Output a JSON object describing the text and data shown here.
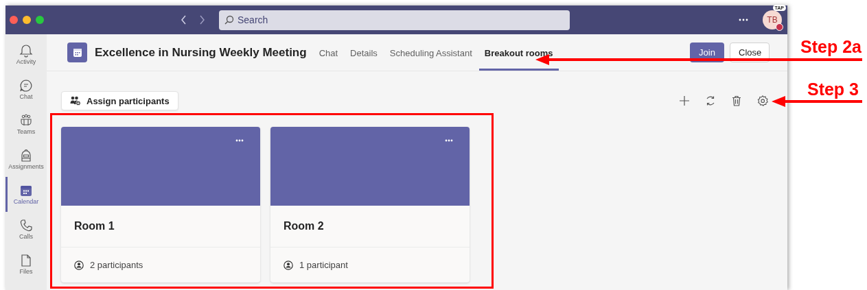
{
  "title_bar": {
    "search": {
      "placeholder": "Search"
    },
    "avatar": {
      "initials": "TB",
      "badge": "TAP"
    }
  },
  "sidebar": {
    "items": [
      {
        "label": "Activity",
        "selected": false
      },
      {
        "label": "Chat",
        "selected": false
      },
      {
        "label": "Teams",
        "selected": false
      },
      {
        "label": "Assignments",
        "selected": false
      },
      {
        "label": "Calendar",
        "selected": true
      },
      {
        "label": "Calls",
        "selected": false
      },
      {
        "label": "Files",
        "selected": false
      }
    ]
  },
  "meeting": {
    "title": "Excellence in Nursing Weekly Meeting",
    "tabs": [
      {
        "label": "Chat",
        "selected": false
      },
      {
        "label": "Details",
        "selected": false
      },
      {
        "label": "Scheduling Assistant",
        "selected": false
      },
      {
        "label": "Breakout rooms",
        "selected": true
      }
    ],
    "buttons": [
      {
        "label": "Join",
        "kind": "primary"
      },
      {
        "label": "Close",
        "kind": "secondary"
      }
    ]
  },
  "toolbar": {
    "assign_button": "Assign participants"
  },
  "rooms": [
    {
      "name": "Room 1",
      "participants": "2 participants"
    },
    {
      "name": "Room 2",
      "participants": "1 participant"
    }
  ],
  "annotations": [
    {
      "label": "Step 2a"
    },
    {
      "label": "Step 3"
    }
  ]
}
